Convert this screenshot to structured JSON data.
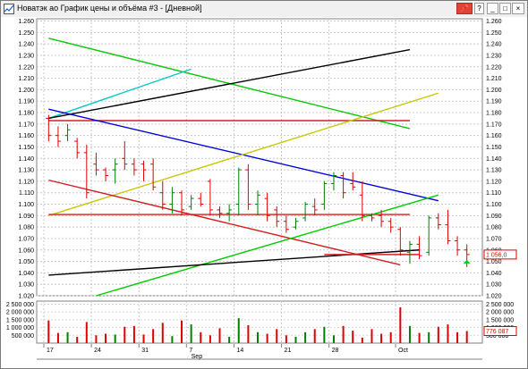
{
  "window": {
    "title": "Новатэк ао График цены и объёма #3 - [Дневной]",
    "buttons": [
      {
        "name": "pin-button",
        "label": "📌"
      },
      {
        "name": "help-button",
        "label": "?"
      },
      {
        "name": "minimize-button",
        "label": "_"
      },
      {
        "name": "maximize-button",
        "label": "□"
      },
      {
        "name": "close-button",
        "label": "×"
      }
    ]
  },
  "chart_data": [
    {
      "type": "bar",
      "subtype": "ohlc-price",
      "y_ticks": [
        "1.020",
        "1.030",
        "1.040",
        "1.050",
        "1.060",
        "1.070",
        "1.080",
        "1.090",
        "1.100",
        "1.110",
        "1.120",
        "1.130",
        "1.140",
        "1.150",
        "1.160",
        "1.170",
        "1.180",
        "1.190",
        "1.200",
        "1.210",
        "1.220",
        "1.230",
        "1.240",
        "1.250",
        "1.260"
      ],
      "ylim": [
        1020,
        1262
      ],
      "grid": true,
      "current_price_label": "1 056,0",
      "current_price": 1056,
      "ohlc": [
        {
          "o": 1175,
          "h": 1178,
          "l": 1155,
          "c": 1160
        },
        {
          "o": 1160,
          "h": 1168,
          "l": 1150,
          "c": 1155
        },
        {
          "o": 1160,
          "h": 1170,
          "l": 1155,
          "c": 1165
        },
        {
          "o": 1155,
          "h": 1158,
          "l": 1140,
          "c": 1145
        },
        {
          "o": 1145,
          "h": 1152,
          "l": 1105,
          "c": 1110
        },
        {
          "o": 1135,
          "h": 1145,
          "l": 1125,
          "c": 1130
        },
        {
          "o": 1130,
          "h": 1132,
          "l": 1120,
          "c": 1125
        },
        {
          "o": 1130,
          "h": 1140,
          "l": 1118,
          "c": 1135
        },
        {
          "o": 1140,
          "h": 1155,
          "l": 1130,
          "c": 1135
        },
        {
          "o": 1135,
          "h": 1140,
          "l": 1125,
          "c": 1130
        },
        {
          "o": 1135,
          "h": 1138,
          "l": 1120,
          "c": 1130
        },
        {
          "o": 1135,
          "h": 1140,
          "l": 1112,
          "c": 1115
        },
        {
          "o": 1110,
          "h": 1120,
          "l": 1095,
          "c": 1100
        },
        {
          "o": 1100,
          "h": 1115,
          "l": 1092,
          "c": 1110
        },
        {
          "o": 1110,
          "h": 1112,
          "l": 1090,
          "c": 1095
        },
        {
          "o": 1098,
          "h": 1108,
          "l": 1095,
          "c": 1105
        },
        {
          "o": 1105,
          "h": 1110,
          "l": 1098,
          "c": 1100
        },
        {
          "o": 1120,
          "h": 1122,
          "l": 1090,
          "c": 1095
        },
        {
          "o": 1095,
          "h": 1098,
          "l": 1088,
          "c": 1092
        },
        {
          "o": 1092,
          "h": 1100,
          "l": 1085,
          "c": 1095
        },
        {
          "o": 1100,
          "h": 1132,
          "l": 1090,
          "c": 1130
        },
        {
          "o": 1130,
          "h": 1135,
          "l": 1095,
          "c": 1100
        },
        {
          "o": 1100,
          "h": 1112,
          "l": 1090,
          "c": 1108
        },
        {
          "o": 1105,
          "h": 1110,
          "l": 1085,
          "c": 1090
        },
        {
          "o": 1095,
          "h": 1098,
          "l": 1080,
          "c": 1085
        },
        {
          "o": 1085,
          "h": 1090,
          "l": 1075,
          "c": 1078
        },
        {
          "o": 1080,
          "h": 1088,
          "l": 1078,
          "c": 1085
        },
        {
          "o": 1088,
          "h": 1102,
          "l": 1085,
          "c": 1100
        },
        {
          "o": 1098,
          "h": 1105,
          "l": 1090,
          "c": 1095
        },
        {
          "o": 1100,
          "h": 1120,
          "l": 1095,
          "c": 1118
        },
        {
          "o": 1118,
          "h": 1128,
          "l": 1112,
          "c": 1125
        },
        {
          "o": 1125,
          "h": 1128,
          "l": 1105,
          "c": 1110
        },
        {
          "o": 1118,
          "h": 1128,
          "l": 1112,
          "c": 1115
        },
        {
          "o": 1108,
          "h": 1120,
          "l": 1085,
          "c": 1090
        },
        {
          "o": 1090,
          "h": 1092,
          "l": 1085,
          "c": 1088
        },
        {
          "o": 1090,
          "h": 1095,
          "l": 1080,
          "c": 1085
        },
        {
          "o": 1085,
          "h": 1088,
          "l": 1075,
          "c": 1080
        },
        {
          "o": 1078,
          "h": 1080,
          "l": 1055,
          "c": 1060
        },
        {
          "o": 1058,
          "h": 1068,
          "l": 1048,
          "c": 1065
        },
        {
          "o": 1065,
          "h": 1072,
          "l": 1052,
          "c": 1055
        },
        {
          "o": 1058,
          "h": 1090,
          "l": 1055,
          "c": 1088
        },
        {
          "o": 1088,
          "h": 1092,
          "l": 1078,
          "c": 1082
        },
        {
          "o": 1082,
          "h": 1095,
          "l": 1065,
          "c": 1068
        },
        {
          "o": 1068,
          "h": 1072,
          "l": 1055,
          "c": 1060
        },
        {
          "o": 1060,
          "h": 1065,
          "l": 1045,
          "c": 1056
        }
      ],
      "lines": [
        {
          "color": "#00cc00",
          "from": [
            0,
            1245
          ],
          "to": [
            38,
            1166
          ]
        },
        {
          "color": "#00c8c8",
          "from": [
            0,
            1175
          ],
          "to": [
            15,
            1218
          ]
        },
        {
          "color": "#000000",
          "from": [
            0,
            1175
          ],
          "to": [
            38,
            1235
          ]
        },
        {
          "color": "#d22020",
          "from": [
            0,
            1173
          ],
          "to": [
            38,
            1173
          ]
        },
        {
          "color": "#0000dd",
          "from": [
            0,
            1183
          ],
          "to": [
            41,
            1103
          ]
        },
        {
          "color": "#c8c800",
          "from": [
            0,
            1090
          ],
          "to": [
            41,
            1197
          ]
        },
        {
          "color": "#d22020",
          "from": [
            0,
            1091
          ],
          "to": [
            38,
            1091
          ]
        },
        {
          "color": "#d22020",
          "from": [
            0,
            1121
          ],
          "to": [
            37,
            1047
          ]
        },
        {
          "color": "#00cc00",
          "from": [
            5,
            1020
          ],
          "to": [
            41,
            1108
          ]
        },
        {
          "color": "#000000",
          "from": [
            0,
            1038
          ],
          "to": [
            39,
            1060
          ]
        },
        {
          "color": "#d22020",
          "from": [
            29,
            1056
          ],
          "to": [
            39,
            1056
          ]
        }
      ]
    },
    {
      "type": "bar",
      "subtype": "volume",
      "y_ticks": [
        "500 000",
        "1 000 000",
        "1 500 000",
        "2 000 000",
        "2 500 000"
      ],
      "ylim": [
        0,
        2700000
      ],
      "current_volume_label": "776 087",
      "values": [
        1450000,
        650000,
        700000,
        400000,
        1350000,
        500000,
        600000,
        550000,
        1050000,
        1100000,
        550000,
        900000,
        1300000,
        450000,
        1450000,
        1200000,
        700000,
        500000,
        950000,
        400000,
        1600000,
        1150000,
        700000,
        600000,
        900000,
        500000,
        400000,
        700000,
        900000,
        1050000,
        500000,
        1100000,
        800000,
        350000,
        900000,
        600000,
        700000,
        2300000,
        1100000,
        650000,
        700000,
        1050000,
        1200000,
        700000,
        776087
      ],
      "colors_up_down": {
        "up": "#008000",
        "down": "#e00000"
      }
    }
  ],
  "x_axis": {
    "day_labels": [
      "17",
      "24",
      "31",
      "7",
      "14",
      "21",
      "28",
      "Oct"
    ],
    "month_label": "Sep"
  }
}
